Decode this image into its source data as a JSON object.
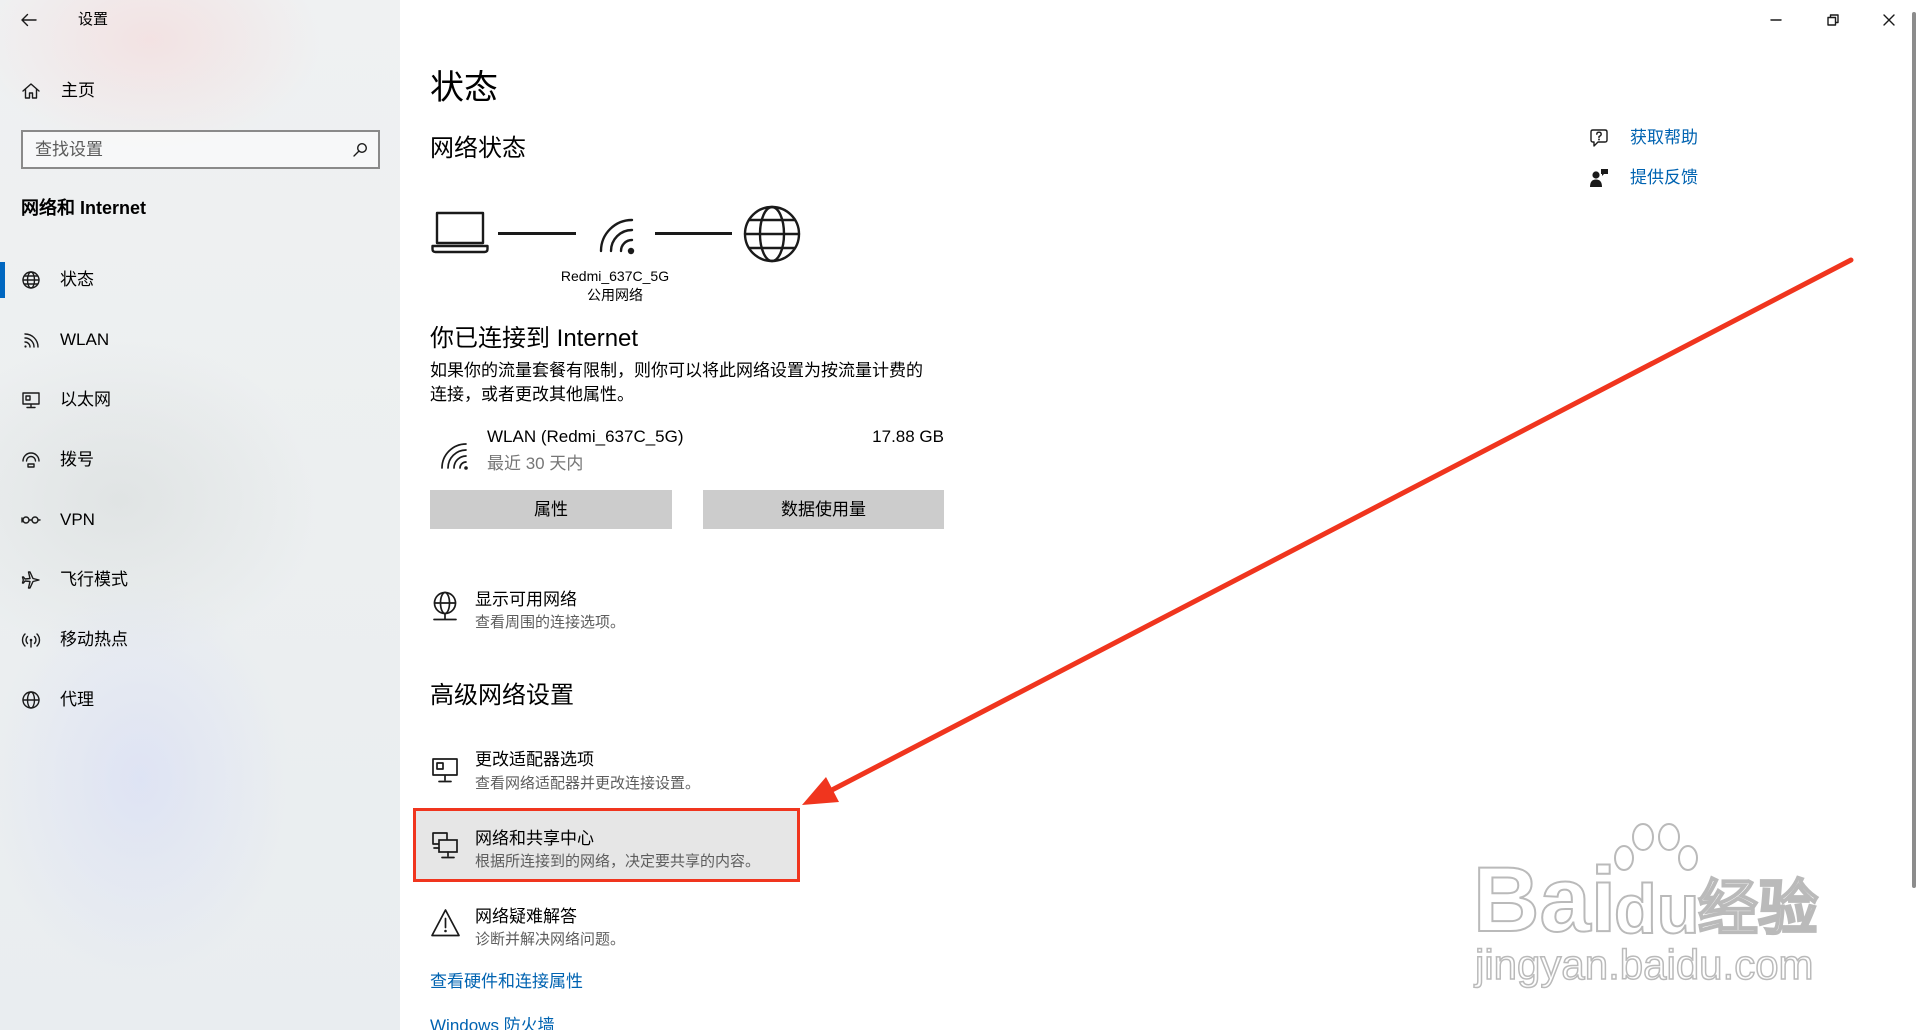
{
  "window": {
    "title": "设置"
  },
  "sidebar": {
    "home_label": "主页",
    "search_placeholder": "查找设置",
    "section_title": "网络和 Internet",
    "items": [
      {
        "label": "状态",
        "icon": "globe-status-icon",
        "selected": true
      },
      {
        "label": "WLAN",
        "icon": "wifi-icon"
      },
      {
        "label": "以太网",
        "icon": "ethernet-icon"
      },
      {
        "label": "拨号",
        "icon": "dialup-icon"
      },
      {
        "label": "VPN",
        "icon": "vpn-icon"
      },
      {
        "label": "飞行模式",
        "icon": "airplane-icon"
      },
      {
        "label": "移动热点",
        "icon": "hotspot-icon"
      },
      {
        "label": "代理",
        "icon": "proxy-globe-icon"
      }
    ]
  },
  "main": {
    "page_title": "状态",
    "network_status_heading": "网络状态",
    "diagram": {
      "network_name": "Redmi_637C_5G",
      "network_type": "公用网络"
    },
    "connected_heading": "你已连接到 Internet",
    "connected_description": [
      "如果你的流量套餐有限制，则你可以将此网络设置为按流量计费的",
      "连接，或者更改其他属性。"
    ],
    "connection": {
      "name": "WLAN (Redmi_637C_5G)",
      "period": "最近 30 天内",
      "usage": "17.88 GB"
    },
    "buttons": {
      "properties": "属性",
      "data_usage": "数据使用量"
    },
    "show_networks": {
      "title": "显示可用网络",
      "subtitle": "查看周围的连接选项。"
    },
    "advanced_heading": "高级网络设置",
    "advanced_items": [
      {
        "title": "更改适配器选项",
        "subtitle": "查看网络适配器并更改连接设置。"
      },
      {
        "title": "网络和共享中心",
        "subtitle": "根据所连接到的网络，决定要共享的内容。",
        "highlighted": true
      },
      {
        "title": "网络疑难解答",
        "subtitle": "诊断并解决网络问题。"
      }
    ],
    "links": [
      "查看硬件和连接属性",
      "Windows 防火墙"
    ]
  },
  "side_links": {
    "help": "获取帮助",
    "feedback": "提供反馈"
  },
  "watermark": {
    "brand_left": "Bai",
    "brand_right": "du",
    "brand_cn": "经验",
    "url": "jingyan.baidu.com"
  },
  "colors": {
    "accent": "#0067c0",
    "link": "#0063b1",
    "annotation": "#f0351e",
    "highlight_bg": "#e6e6e6",
    "button_bg": "#cccccc"
  }
}
